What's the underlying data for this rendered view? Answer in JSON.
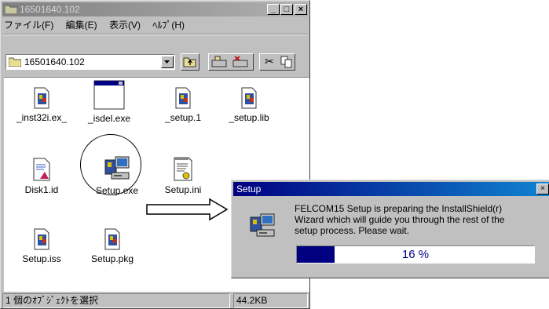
{
  "window": {
    "title": "16501640.102",
    "minimize_glyph": "_",
    "maximize_glyph": "□",
    "close_glyph": "×"
  },
  "menu": [
    "ファイル(F)",
    "編集(E)",
    "表示(V)",
    "ﾍﾙﾌﾟ(H)"
  ],
  "address": {
    "value": "16501640.102"
  },
  "toolbar": {
    "cut_glyph": "✂"
  },
  "files": [
    {
      "name": "_inst32i.ex_",
      "icon": "installshield-file-icon"
    },
    {
      "name": "_isdel.exe",
      "icon": "window-app-icon"
    },
    {
      "name": "_setup.1",
      "icon": "installshield-file-icon"
    },
    {
      "name": "_setup.lib",
      "icon": "installshield-file-icon"
    },
    {
      "name": "Disk1.id",
      "icon": "document-icon"
    },
    {
      "name": "Setup.exe",
      "icon": "setup-computer-icon"
    },
    {
      "name": "Setup.ini",
      "icon": "settings-file-icon"
    },
    {
      "name": "Setup.iss",
      "icon": "installshield-file-icon"
    },
    {
      "name": "Setup.pkg",
      "icon": "installshield-file-icon"
    }
  ],
  "status": {
    "selection": "1 個のｵﾌﾞｼﾞｪｸﾄを選択",
    "size": "44.2KB"
  },
  "dialog": {
    "title": "Setup",
    "close_glyph": "×",
    "message_lines": [
      "FELCOM15 Setup is preparing the InstallShield(r)",
      "Wizard which will guide you through the rest of the",
      "setup process.  Please wait."
    ],
    "progress_label": "16 %",
    "progress_fraction": 0.16
  },
  "colors": {
    "dialog_title": "#000080",
    "progress_fill": "#000080"
  }
}
